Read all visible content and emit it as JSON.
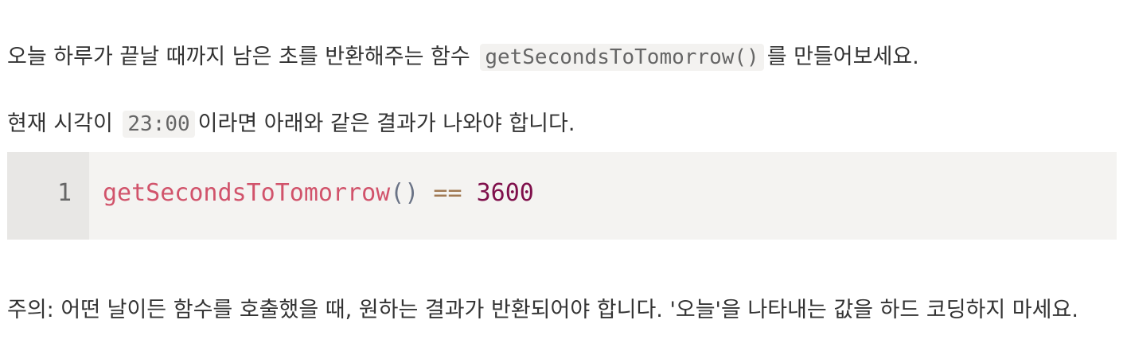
{
  "paragraph1": {
    "before": "오늘 하루가 끝날 때까지 남은 초를 반환해주는 함수",
    "code": "getSecondsToTomorrow()",
    "after": "를 만들어보세요."
  },
  "paragraph2": {
    "before": "현재 시각이",
    "code": "23:00",
    "after": "이라면 아래와 같은 결과가 나와야 합니다."
  },
  "code_block": {
    "line_number": "1",
    "tokens": {
      "fn": "getSecondsToTomorrow",
      "parens": "()",
      "op": "==",
      "num": "3600"
    }
  },
  "paragraph3": {
    "text": "주의: 어떤 날이든 함수를 호출했을 때, 원하는 결과가 반환되어야 합니다. '오늘'을 나타내는 값을 하드 코딩하지 마세요."
  }
}
